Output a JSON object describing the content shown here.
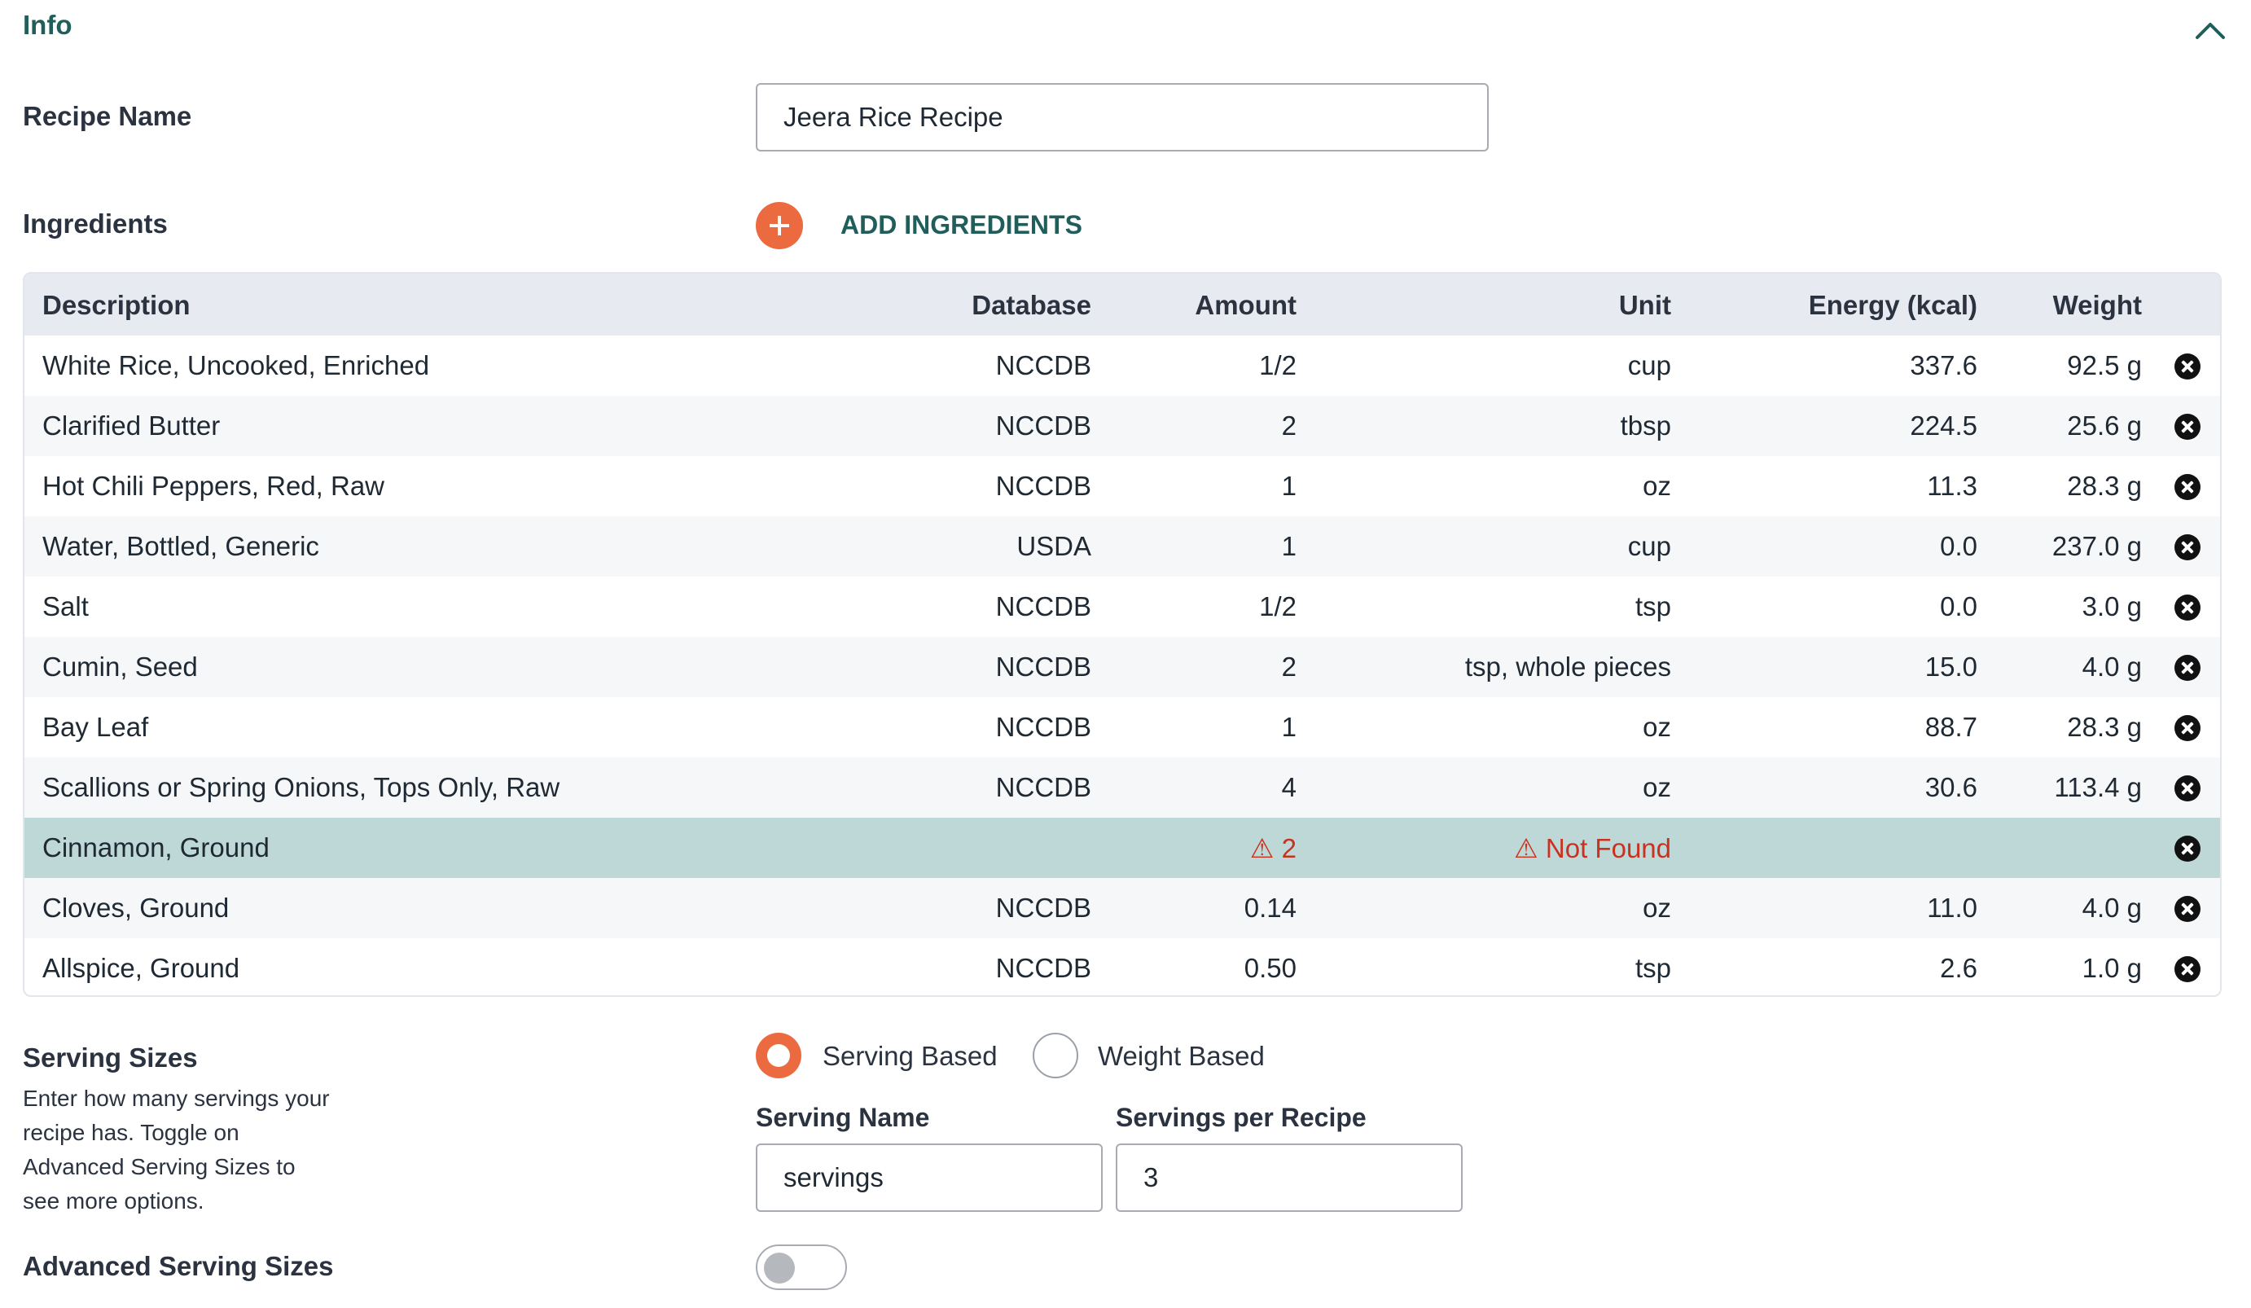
{
  "section": {
    "title": "Info"
  },
  "recipe": {
    "label": "Recipe Name",
    "value": "Jeera Rice Recipe"
  },
  "ingredients": {
    "label": "Ingredients",
    "add_label": "ADD INGREDIENTS",
    "columns": [
      "Description",
      "Database",
      "Amount",
      "Unit",
      "Energy (kcal)",
      "Weight"
    ],
    "rows": [
      {
        "description": "White Rice, Uncooked, Enriched",
        "database": "NCCDB",
        "amount": "1/2",
        "unit": "cup",
        "energy": "337.6",
        "weight": "92.5 g"
      },
      {
        "description": "Clarified Butter",
        "database": "NCCDB",
        "amount": "2",
        "unit": "tbsp",
        "energy": "224.5",
        "weight": "25.6 g"
      },
      {
        "description": "Hot Chili Peppers, Red, Raw",
        "database": "NCCDB",
        "amount": "1",
        "unit": "oz",
        "energy": "11.3",
        "weight": "28.3 g"
      },
      {
        "description": "Water, Bottled, Generic",
        "database": "USDA",
        "amount": "1",
        "unit": "cup",
        "energy": "0.0",
        "weight": "237.0 g"
      },
      {
        "description": "Salt",
        "database": "NCCDB",
        "amount": "1/2",
        "unit": "tsp",
        "energy": "0.0",
        "weight": "3.0 g"
      },
      {
        "description": "Cumin, Seed",
        "database": "NCCDB",
        "amount": "2",
        "unit": "tsp, whole pieces",
        "energy": "15.0",
        "weight": "4.0 g"
      },
      {
        "description": "Bay Leaf",
        "database": "NCCDB",
        "amount": "1",
        "unit": "oz",
        "energy": "88.7",
        "weight": "28.3 g"
      },
      {
        "description": "Scallions or Spring Onions, Tops Only, Raw",
        "database": "NCCDB",
        "amount": "4",
        "unit": "oz",
        "energy": "30.6",
        "weight": "113.4 g"
      },
      {
        "description": "Cinnamon, Ground",
        "database": "",
        "amount": "⚠ 2",
        "unit": "⚠ Not Found",
        "energy": "",
        "weight": ""
      },
      {
        "description": "Cloves, Ground",
        "database": "NCCDB",
        "amount": "0.14",
        "unit": "oz",
        "energy": "11.0",
        "weight": "4.0 g"
      },
      {
        "description": "Allspice, Ground",
        "database": "NCCDB",
        "amount": "0.50",
        "unit": "tsp",
        "energy": "2.6",
        "weight": "1.0 g"
      }
    ]
  },
  "serving": {
    "label": "Serving Sizes",
    "help": "Enter how many servings your recipe has. Toggle on Advanced Serving Sizes to see more options.",
    "option_serving": "Serving Based",
    "option_weight": "Weight Based",
    "selected": "Serving Based",
    "name_label": "Serving Name",
    "name_value": "servings",
    "per_recipe_label": "Servings per Recipe",
    "per_recipe_value": "3"
  },
  "advanced": {
    "label": "Advanced Serving Sizes",
    "enabled": false
  },
  "colors": {
    "accent": "#ec6a3f",
    "heading": "#1f5e5a",
    "warning": "#c8321e",
    "selected_row": "#bed8d8"
  }
}
